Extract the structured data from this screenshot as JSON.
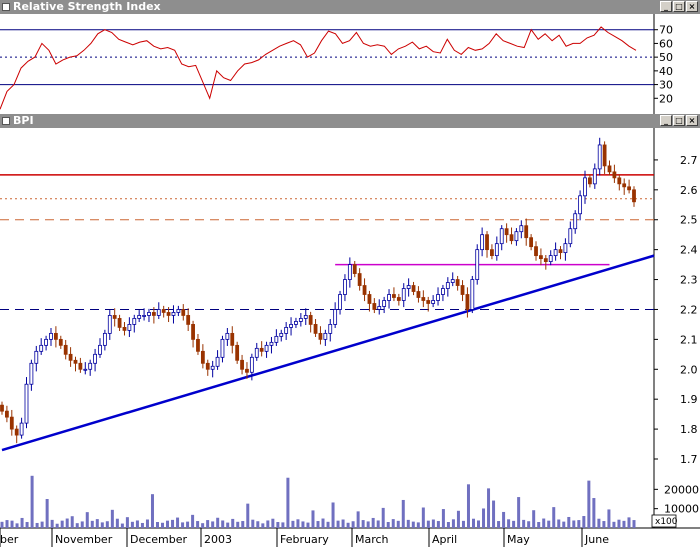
{
  "window_controls": [
    "_",
    "□",
    "×"
  ],
  "chart_data": [
    {
      "type": "line",
      "title": "Relative Strength Index",
      "ylim": [
        10,
        80
      ],
      "yticks": [
        20,
        30,
        40,
        50,
        60,
        70
      ],
      "reference_lines": [
        {
          "y": 70,
          "style": "solid",
          "color": "#000080"
        },
        {
          "y": 50,
          "style": "dotted",
          "color": "#000080"
        },
        {
          "y": 30,
          "style": "solid",
          "color": "#000080"
        }
      ],
      "series": [
        {
          "color": "#cc0000",
          "values": [
            12,
            25,
            30,
            42,
            47,
            50,
            60,
            55,
            45,
            48,
            50,
            51,
            55,
            60,
            67,
            70,
            68,
            63,
            61,
            59,
            61,
            62,
            58,
            56,
            57,
            55,
            45,
            43,
            44,
            32,
            20,
            40,
            35,
            33,
            40,
            45,
            46,
            48,
            52,
            55,
            58,
            60,
            62,
            59,
            50,
            53,
            62,
            69,
            67,
            60,
            62,
            68,
            60,
            58,
            59,
            58,
            52,
            56,
            58,
            61,
            56,
            58,
            54,
            53,
            63,
            55,
            52,
            57,
            55,
            56,
            60,
            67,
            62,
            60,
            58,
            57,
            70,
            63,
            67,
            62,
            66,
            58,
            60,
            60,
            64,
            66,
            72,
            68,
            65,
            62,
            58,
            55
          ]
        }
      ]
    },
    {
      "type": "candlestick",
      "title": "BPI",
      "ylim": [
        1.69,
        2.8
      ],
      "yticks": [
        1.7,
        1.8,
        1.9,
        2.0,
        2.1,
        2.2,
        2.3,
        2.4,
        2.5,
        2.6,
        2.7
      ],
      "x_labels": [
        "ber",
        "November",
        "December",
        "2003",
        "February",
        "March",
        "April",
        "May",
        "June"
      ],
      "closes": [
        1.86,
        1.84,
        1.8,
        1.78,
        1.82,
        1.95,
        2.02,
        2.06,
        2.08,
        2.1,
        2.12,
        2.1,
        2.08,
        2.05,
        2.03,
        2.02,
        2.0,
        2.0,
        2.02,
        2.05,
        2.08,
        2.12,
        2.18,
        2.17,
        2.14,
        2.13,
        2.15,
        2.17,
        2.18,
        2.18,
        2.19,
        2.18,
        2.2,
        2.19,
        2.18,
        2.19,
        2.2,
        2.18,
        2.15,
        2.1,
        2.06,
        2.02,
        2.0,
        2.01,
        2.04,
        2.1,
        2.12,
        2.08,
        2.03,
        2.0,
        1.99,
        2.04,
        2.07,
        2.06,
        2.08,
        2.09,
        2.11,
        2.12,
        2.14,
        2.15,
        2.16,
        2.17,
        2.18,
        2.15,
        2.12,
        2.1,
        2.12,
        2.15,
        2.2,
        2.25,
        2.3,
        2.35,
        2.32,
        2.28,
        2.25,
        2.22,
        2.2,
        2.21,
        2.23,
        2.25,
        2.24,
        2.23,
        2.27,
        2.28,
        2.26,
        2.24,
        2.23,
        2.22,
        2.23,
        2.25,
        2.27,
        2.29,
        2.3,
        2.28,
        2.25,
        2.2,
        2.3,
        2.4,
        2.45,
        2.4,
        2.38,
        2.42,
        2.47,
        2.45,
        2.43,
        2.46,
        2.48,
        2.44,
        2.41,
        2.38,
        2.37,
        2.36,
        2.38,
        2.4,
        2.39,
        2.42,
        2.47,
        2.52,
        2.58,
        2.64,
        2.62,
        2.67,
        2.75,
        2.68,
        2.66,
        2.64,
        2.62,
        2.61,
        2.6,
        2.56
      ],
      "reference_lines": [
        {
          "y": 2.65,
          "style": "solid",
          "color": "#cc0000"
        },
        {
          "y": 2.57,
          "style": "dotted",
          "color": "#cc6633"
        },
        {
          "y": 2.5,
          "style": "dashed",
          "color": "#cc6633"
        },
        {
          "y": 2.2,
          "style": "dashed",
          "color": "#000080"
        }
      ],
      "segments": [
        {
          "name": "support-trendline",
          "from": [
            0,
            1.73
          ],
          "to": [
            136,
            2.38
          ],
          "color": "#0000cc"
        },
        {
          "name": "resistance-line",
          "from": [
            68,
            2.35
          ],
          "to": [
            124,
            2.35
          ],
          "color": "#cc00cc"
        }
      ],
      "colors": {
        "up": "#0000a0",
        "down": "#993300"
      }
    },
    {
      "type": "bar",
      "ylim": [
        0,
        30000
      ],
      "yticks": [
        10000,
        20000
      ],
      "unit_label": "x100",
      "bar_color": "#7070c0",
      "values": [
        3200,
        4100,
        3800,
        2400,
        5200,
        3100,
        27000,
        2600,
        3300,
        15000,
        4200,
        2200,
        3800,
        4900,
        6100,
        2500,
        3400,
        8200,
        3700,
        4600,
        2900,
        3500,
        9400,
        4800,
        2300,
        5600,
        3200,
        3900,
        2600,
        4400,
        17500,
        3100,
        2700,
        3800,
        4200,
        5400,
        2900,
        3300,
        6800,
        3600,
        2500,
        4100,
        3400,
        5300,
        3900,
        2800,
        4700,
        3200,
        3600,
        12600,
        4300,
        3500,
        2400,
        3900,
        4800,
        3100,
        2900,
        26000,
        3700,
        4500,
        3400,
        2800,
        9100,
        3600,
        4900,
        3200,
        13200,
        3800,
        4400,
        2700,
        3500,
        8600,
        4100,
        3400,
        5200,
        3900,
        10400,
        3100,
        4600,
        3700,
        14500,
        4200,
        3300,
        2900,
        10600,
        3800,
        4400,
        3600,
        9800,
        3100,
        4500,
        8900,
        3700,
        22600,
        4800,
        3900,
        10100,
        20500,
        14200,
        3600,
        8300,
        4500,
        3700,
        16000,
        4200,
        3500,
        9200,
        3100,
        4900,
        3800,
        10800,
        4400,
        3300,
        5700,
        3900,
        4100,
        6200,
        24500,
        15500,
        4800,
        3600,
        9600,
        3200,
        4300,
        3700,
        5500,
        4100
      ]
    }
  ]
}
